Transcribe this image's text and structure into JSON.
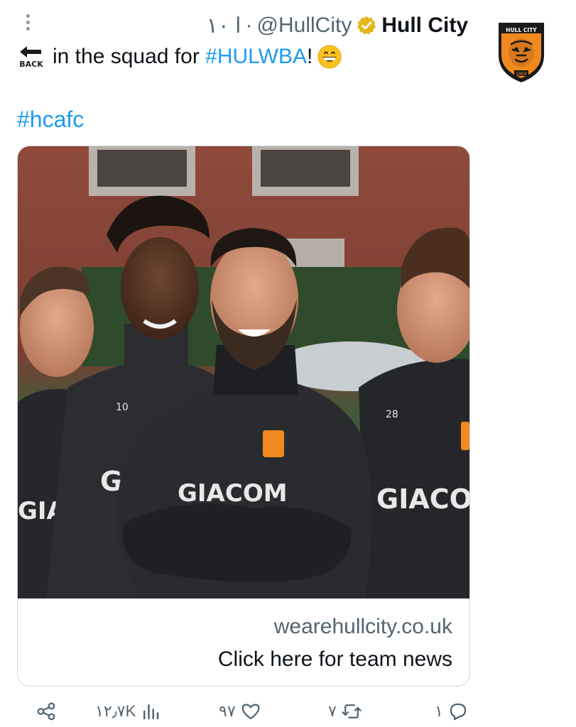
{
  "header": {
    "time": "۱۰ ا",
    "separator": "·",
    "handle": "@HullCity",
    "display_name": "Hull City",
    "verified_icon": "verified-badge-gold",
    "avatar_icon": "hull-city-crest"
  },
  "tweet": {
    "back_icon_label": "BACK",
    "text_prefix": "in the squad for ",
    "hashtag_match": "#HULWBA",
    "text_suffix": "!",
    "emoji": "grinning-face-emoji",
    "hashtag_club": "#hcafc"
  },
  "card": {
    "photo_icon": "team-training-photo",
    "jersey_left": "GIA",
    "jersey_mid_left": "GI",
    "jersey_center": "GIACOM",
    "jersey_right": "GIACOM",
    "number_left": "10",
    "number_right": "28",
    "domain": "wearehullcity.co.uk",
    "title": "Click here for team news"
  },
  "actions": {
    "share_icon": "share-icon",
    "views_icon": "views-chart-icon",
    "views_count": "۱۲٫۷K",
    "like_icon": "heart-icon",
    "like_count": "۹۷",
    "retweet_icon": "retweet-icon",
    "retweet_count": "۷",
    "reply_icon": "reply-icon",
    "reply_count": "۱"
  },
  "colors": {
    "link": "#1d9bf0",
    "muted": "#536471",
    "verified_gold": "#e2b719",
    "crest_orange": "#f18a1e",
    "brick": "#8d4234"
  }
}
